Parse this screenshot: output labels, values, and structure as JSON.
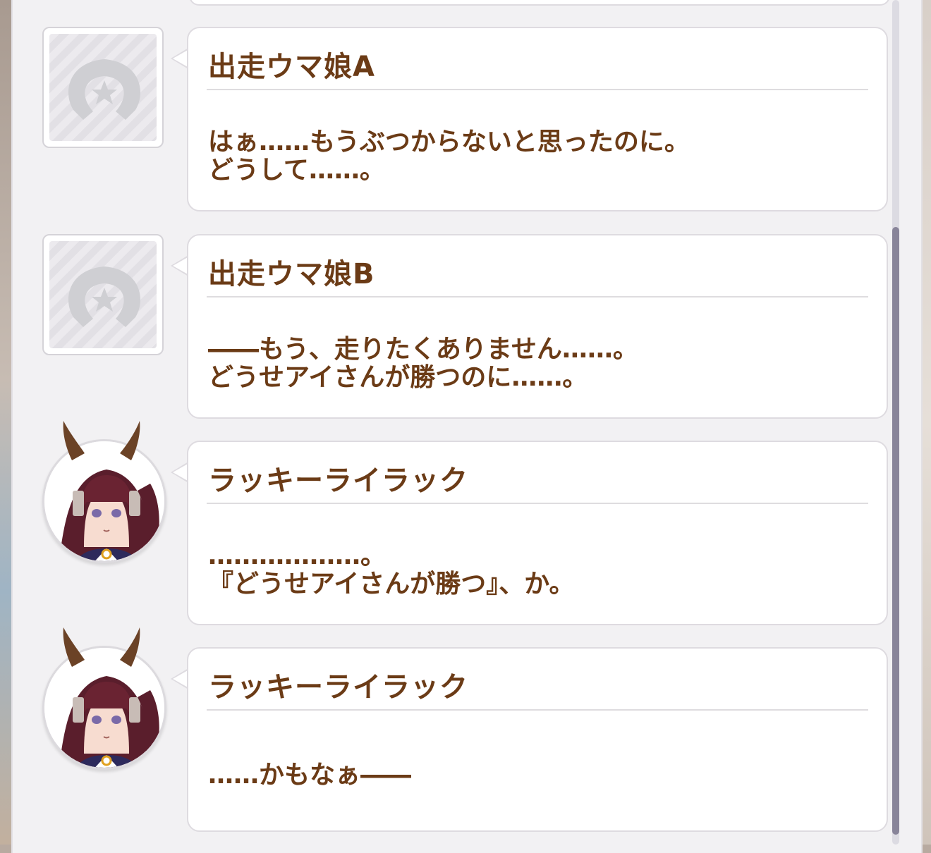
{
  "entries": [
    {
      "speaker": "出走ウマ娘A",
      "avatar": "horseshoe-placeholder-icon",
      "lines": [
        "はぁ……もうぶつからないと思ったのに。",
        "どうして……。"
      ]
    },
    {
      "speaker": "出走ウマ娘B",
      "avatar": "horseshoe-placeholder-icon",
      "lines": [
        "――もう、走りたくありません……。",
        "どうせアイさんが勝つのに……。"
      ]
    },
    {
      "speaker": "ラッキーライラック",
      "avatar": "lucky-lilac-portrait",
      "lines": [
        "………………。",
        "『どうせアイさんが勝つ』、か。"
      ]
    },
    {
      "speaker": "ラッキーライラック",
      "avatar": "lucky-lilac-portrait",
      "lines": [
        "……かもなぁ――"
      ]
    }
  ],
  "colors": {
    "text": "#6b3b16",
    "bubble_border": "#dedbe0",
    "panel_bg": "#f2f1f3",
    "scrollbar_thumb": "#888499"
  }
}
